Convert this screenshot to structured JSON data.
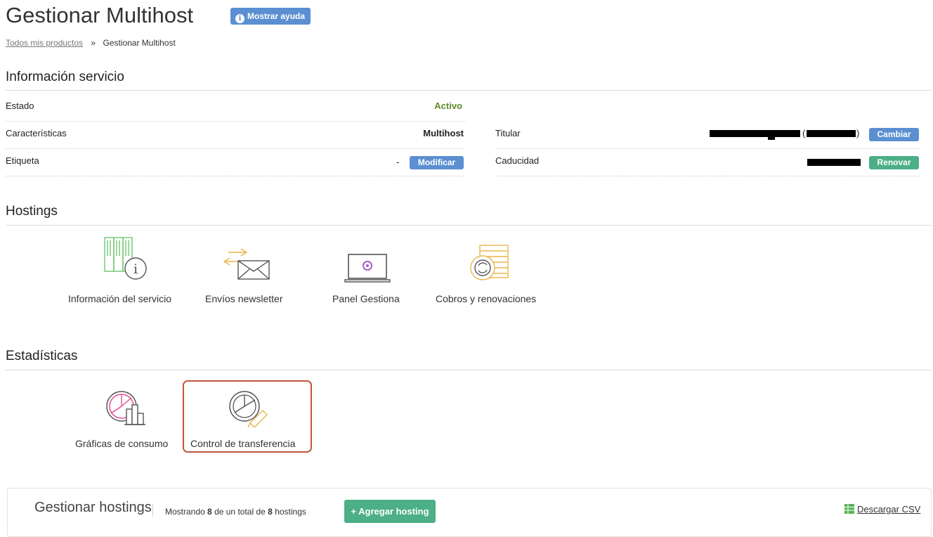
{
  "header": {
    "title": "Gestionar Multihost",
    "help_button": "Mostrar ayuda"
  },
  "breadcrumb": {
    "root": "Todos mis productos",
    "separator": "»",
    "current": "Gestionar Multihost"
  },
  "info": {
    "title": "Información servicio",
    "estado": {
      "label": "Estado",
      "value": "Activo"
    },
    "caracteristicas": {
      "label": "Características",
      "value": "Multihost"
    },
    "etiqueta": {
      "label": "Etiqueta",
      "value": "-",
      "button": "Modificar"
    },
    "titular": {
      "label": "Titular",
      "paren_open": "(",
      "paren_close": ")",
      "button": "Cambiar"
    },
    "caducidad": {
      "label": "Caducidad",
      "button": "Renovar"
    }
  },
  "hostings": {
    "title": "Hostings",
    "tiles": [
      {
        "label": "Información del servicio",
        "icon": "server-info-icon"
      },
      {
        "label": "Envíos newsletter",
        "icon": "envelope-send-icon"
      },
      {
        "label": "Panel Gestiona",
        "icon": "laptop-panel-icon"
      },
      {
        "label": "Cobros y renovaciones",
        "icon": "billing-coins-icon"
      }
    ]
  },
  "stats": {
    "title": "Estadísticas",
    "tiles": [
      {
        "label": "Gráficas de consumo",
        "icon": "pie-bar-chart-icon"
      },
      {
        "label": "Control de transferencia",
        "icon": "pie-chart-edit-icon"
      }
    ]
  },
  "manage": {
    "title": "Gestionar hostings",
    "showing_prefix": "Mostrando",
    "shown": "8",
    "showing_mid": "de un total de",
    "total": "8",
    "showing_suffix": "hostings",
    "add_button": "+ Agregar hosting",
    "download": "Descargar CSV"
  },
  "colors": {
    "accent_blue": "#5b8fd1",
    "accent_green": "#4caf86",
    "active_green": "#5a8a2a",
    "highlight": "#c0573b"
  }
}
